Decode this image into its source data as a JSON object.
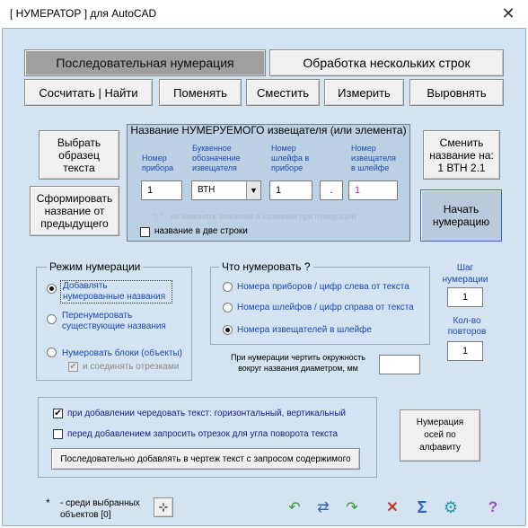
{
  "window": {
    "title": "[ НУМЕРАТОР ]  для AutoCAD",
    "close_glyph": "✕"
  },
  "tabs": [
    {
      "label": "Последовательная нумерация"
    },
    {
      "label": "Обработка  нескольких строк"
    }
  ],
  "toolbar": {
    "count_find": "Сосчитать | Найти",
    "change": "Поменять",
    "shift": "Сместить",
    "measure": "Измерить",
    "align": "Выровнять"
  },
  "left_buttons": {
    "select_sample": "Выбрать образец текста",
    "form_name": "Сформировать название  от предыдущего"
  },
  "name_panel": {
    "title": "Название НУМЕРУЕМОГО извещателя (или элемента)",
    "labels": {
      "device_no": "Номер прибора",
      "letter_code": "Буквенное обозначение извещателя",
      "loop_no": "Номер шлейфа в приборе",
      "detector_no": "Номер извещателя в шлейфе"
    },
    "values": {
      "device_no": "1",
      "letter_code": "ВТН",
      "loop_no": "1",
      "separator": ".",
      "detector_no": "1"
    },
    "hint": "\"=\" - не изменять значение в названии при нумерации",
    "two_lines": "название в две строки"
  },
  "right_buttons": {
    "change_name": "Сменить название на: 1 ВТН 2.1",
    "start": "Начать нумерацию"
  },
  "mode_group": {
    "title": "Режим нумерации",
    "options": [
      "Добавлять нумерованные  названия",
      "Перенумеровать существующие названия",
      "Нумеровать блоки (объекты)"
    ],
    "join_segments": "и соединять отрезками"
  },
  "what_group": {
    "title": "Что нумеровать ?",
    "options": [
      "Номера приборов  /  цифр слева от текста",
      "Номера шлейфов  /  цифр справа от текста",
      "Номера извещателей в шлейфе"
    ]
  },
  "circle": {
    "label": "При нумерации чертить окружность вокруг названия диаметром, мм",
    "value": ""
  },
  "step": {
    "label": "Шаг нумерации",
    "value": "1"
  },
  "repeats": {
    "label": "Кол-во повторов",
    "value": "1"
  },
  "bottom_panel": {
    "alternate": "при добавлении чередовать текст: горизонтальный, вертикальный",
    "ask_segment": "перед добавлением запросить отрезок для угла поворота текста",
    "add_sequential": "Последовательно добавлять в чертеж текст с запросом содержимого"
  },
  "axes_button": "Нумерация осей по алфавиту",
  "footer": {
    "asterisk": "*",
    "selected_text": "- среди выбранных объектов  [0]"
  },
  "icons": {
    "undo": "↶",
    "refresh": "⇄",
    "redo": "↷",
    "tools": "✕",
    "sigma": "Σ",
    "gear": "⚙",
    "help": "?"
  },
  "colors": {
    "client_bg": "#d4e3f1",
    "panel_bg": "#bcd0e4",
    "active_tab": "#9f9f9f",
    "label_blue": "#1a48b5",
    "accent_magenta": "#c020c0"
  }
}
